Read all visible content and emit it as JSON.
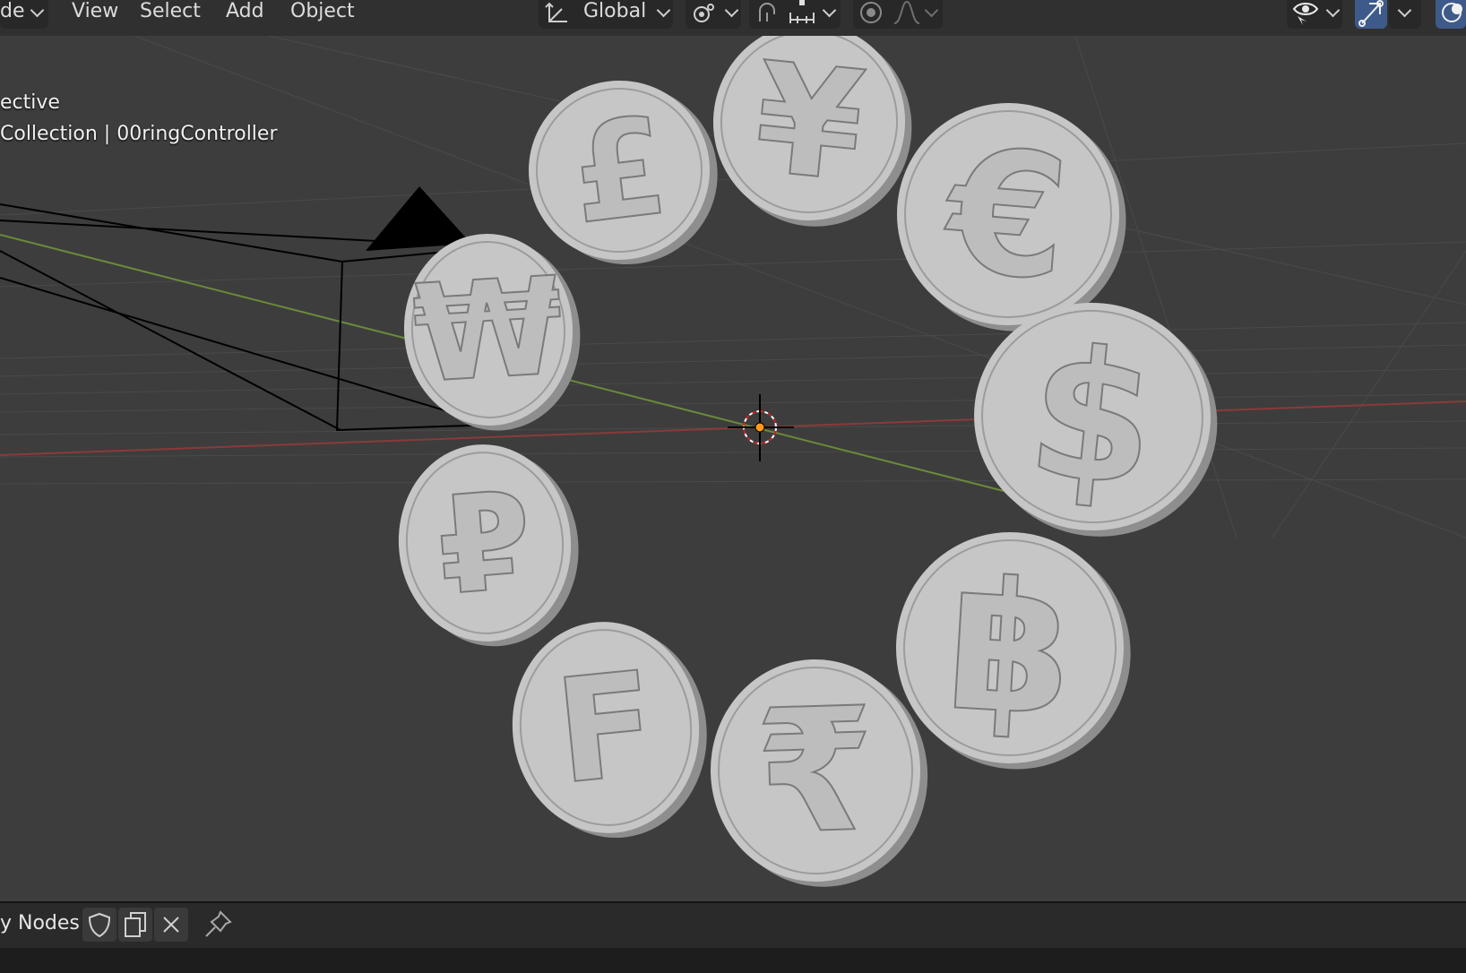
{
  "header": {
    "mode_label": "de",
    "menu": [
      "View",
      "Select",
      "Add",
      "Object"
    ],
    "orientation_label": "Global",
    "icons": [
      "transform-orientation-icon",
      "pivot-point-icon",
      "snap-magnet-icon",
      "snap-increment-icon",
      "proportional-editing-icon",
      "falloff-curve-icon",
      "visibility-eye-icon",
      "gizmo-icon",
      "overlay-icon"
    ]
  },
  "viewport": {
    "view_name": "ective",
    "collection_info": "Collection | 00ringController",
    "coins": [
      "£",
      "¥",
      "€",
      "₩",
      "$",
      "₽",
      "F",
      "₹",
      "฿"
    ],
    "colors": {
      "background": "#3d3d3d",
      "coin": "#c8c8c8",
      "x_axis": "#8a3a3a",
      "y_axis": "#6b8a3a"
    }
  },
  "footer": {
    "editor_label": "y Nodes",
    "icons": [
      "fake-user-shield-icon",
      "duplicate-icon",
      "close-icon",
      "pin-icon"
    ]
  }
}
